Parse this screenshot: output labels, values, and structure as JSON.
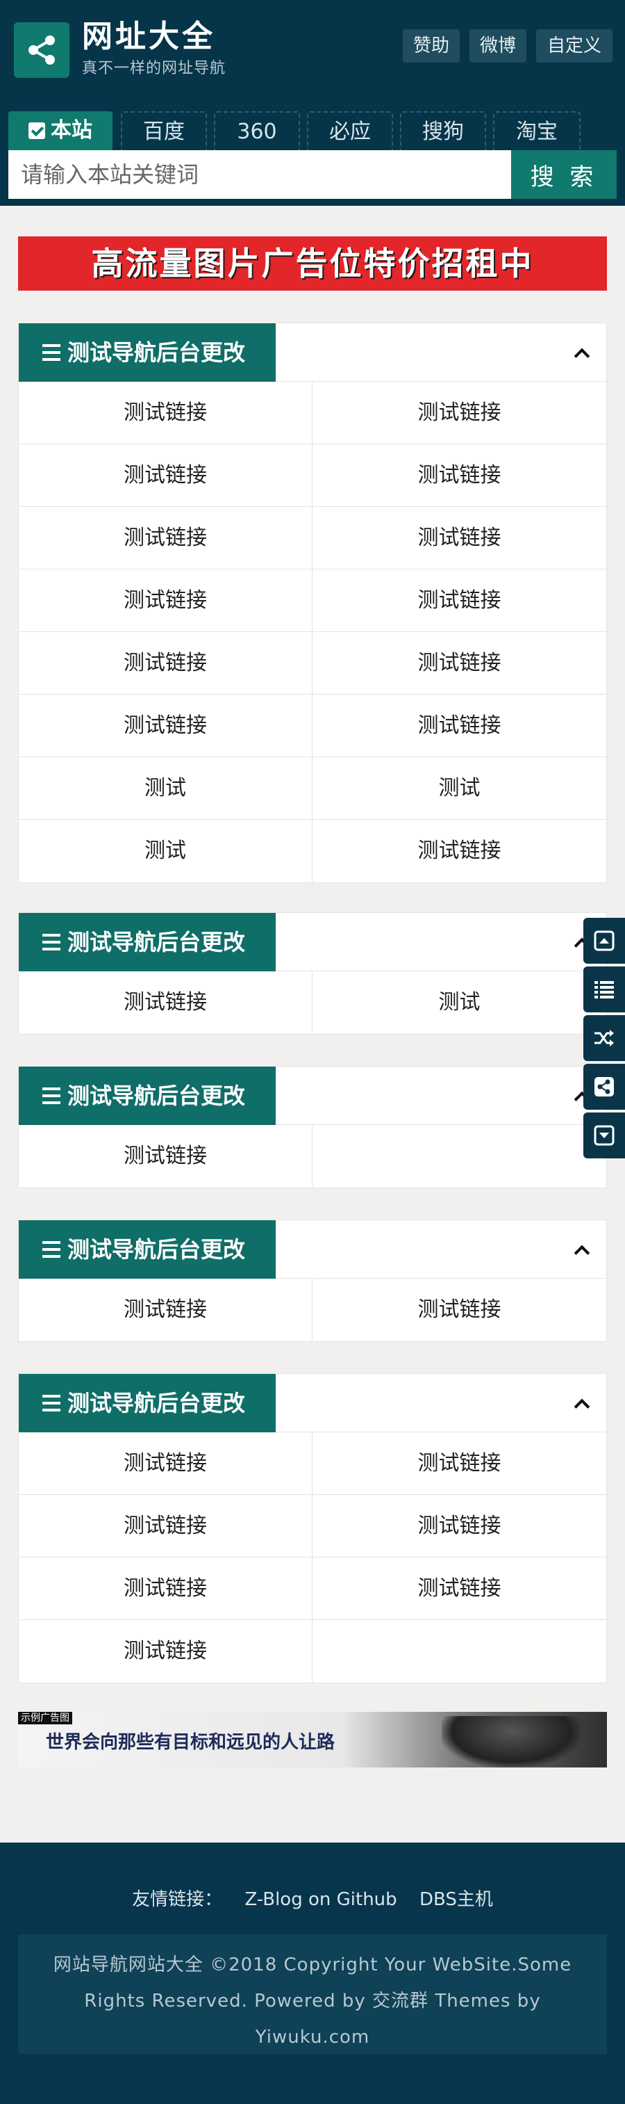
{
  "header": {
    "site_title": "网址大全",
    "site_subtitle": "真不一样的网址导航",
    "buttons": [
      "赞助",
      "微博",
      "自定义"
    ]
  },
  "search": {
    "tabs": [
      "本站",
      "百度",
      "360",
      "必应",
      "搜狗",
      "淘宝"
    ],
    "active_tab": "本站",
    "placeholder": "请输入本站关键词",
    "button_label": "搜 索"
  },
  "banner": {
    "text": "高流量图片广告位特价招租中"
  },
  "sections": [
    {
      "title": "测试导航后台更改",
      "links": [
        "测试链接",
        "测试链接",
        "测试链接",
        "测试链接",
        "测试链接",
        "测试链接",
        "测试链接",
        "测试链接",
        "测试链接",
        "测试链接",
        "测试链接",
        "测试链接",
        "测试",
        "测试",
        "测试",
        "测试链接"
      ]
    },
    {
      "title": "测试导航后台更改",
      "links": [
        "测试链接",
        "测试"
      ]
    },
    {
      "title": "测试导航后台更改",
      "links": [
        "测试链接"
      ]
    },
    {
      "title": "测试导航后台更改",
      "links": [
        "测试链接",
        "测试链接"
      ]
    },
    {
      "title": "测试导航后台更改",
      "links": [
        "测试链接",
        "测试链接",
        "测试链接",
        "测试链接",
        "测试链接",
        "测试链接",
        "测试链接"
      ]
    }
  ],
  "ad": {
    "tag": "示例广告图",
    "text": "世界会向那些有目标和远见的人让路"
  },
  "float_bar": [
    "arrow-up-icon",
    "list-icon",
    "random-icon",
    "share-icon",
    "arrow-down-icon"
  ],
  "footer": {
    "friend_label": "友情链接：",
    "friend_links": [
      "Z-Blog on Github",
      "DBS主机"
    ],
    "copyright": "网站导航网站大全 ©2018 Copyright Your WebSite.Some Rights Reserved. Powered by 交流群 Themes by Yiwuku.com"
  },
  "colors": {
    "header_bg": "#06354a",
    "accent": "#0f7a6d",
    "banner_red": "#e2262a",
    "page_bg": "#f2f0ee"
  }
}
